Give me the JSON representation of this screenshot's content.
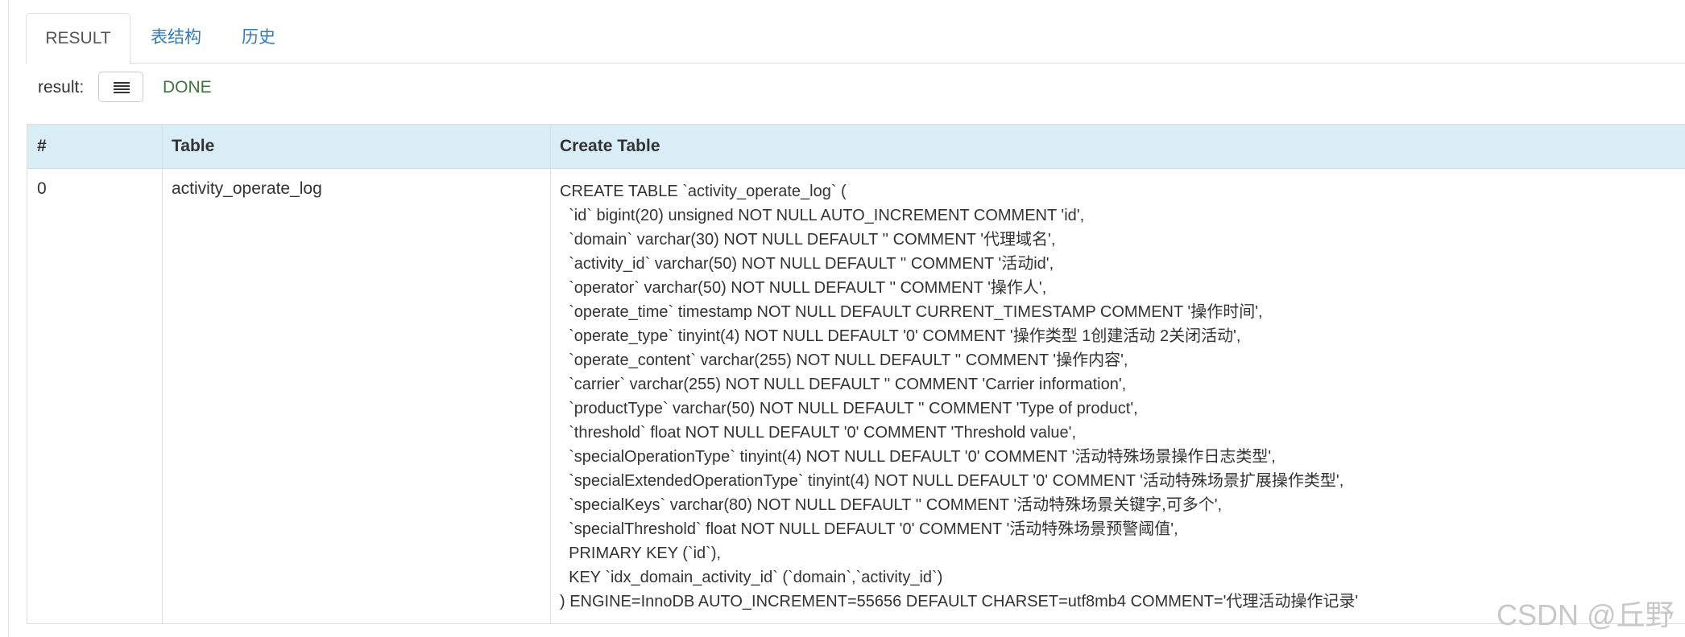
{
  "tabs": [
    {
      "label": "RESULT",
      "active": true
    },
    {
      "label": "表结构",
      "active": false
    },
    {
      "label": "历史",
      "active": false
    }
  ],
  "result": {
    "label": "result:",
    "status": "DONE",
    "status_color": "#3c763d",
    "menu_icon": "list-icon"
  },
  "table": {
    "headers": [
      "#",
      "Table",
      "Create Table"
    ],
    "header_bg": "#d9edf7",
    "rows": [
      {
        "index": "0",
        "table": "activity_operate_log",
        "create_table": "CREATE TABLE `activity_operate_log` (\n  `id` bigint(20) unsigned NOT NULL AUTO_INCREMENT COMMENT 'id',\n  `domain` varchar(30) NOT NULL DEFAULT '' COMMENT '代理域名',\n  `activity_id` varchar(50) NOT NULL DEFAULT '' COMMENT '活动id',\n  `operator` varchar(50) NOT NULL DEFAULT '' COMMENT '操作人',\n  `operate_time` timestamp NOT NULL DEFAULT CURRENT_TIMESTAMP COMMENT '操作时间',\n  `operate_type` tinyint(4) NOT NULL DEFAULT '0' COMMENT '操作类型 1创建活动 2关闭活动',\n  `operate_content` varchar(255) NOT NULL DEFAULT '' COMMENT '操作内容',\n  `carrier` varchar(255) NOT NULL DEFAULT '' COMMENT 'Carrier information',\n  `productType` varchar(50) NOT NULL DEFAULT '' COMMENT 'Type of product',\n  `threshold` float NOT NULL DEFAULT '0' COMMENT 'Threshold value',\n  `specialOperationType` tinyint(4) NOT NULL DEFAULT '0' COMMENT '活动特殊场景操作日志类型',\n  `specialExtendedOperationType` tinyint(4) NOT NULL DEFAULT '0' COMMENT '活动特殊场景扩展操作类型',\n  `specialKeys` varchar(80) NOT NULL DEFAULT '' COMMENT '活动特殊场景关键字,可多个',\n  `specialThreshold` float NOT NULL DEFAULT '0' COMMENT '活动特殊场景预警阈值',\n  PRIMARY KEY (`id`),\n  KEY `idx_domain_activity_id` (`domain`,`activity_id`)\n) ENGINE=InnoDB AUTO_INCREMENT=55656 DEFAULT CHARSET=utf8mb4 COMMENT='代理活动操作记录'"
      }
    ]
  },
  "watermark": "CSDN @丘野"
}
